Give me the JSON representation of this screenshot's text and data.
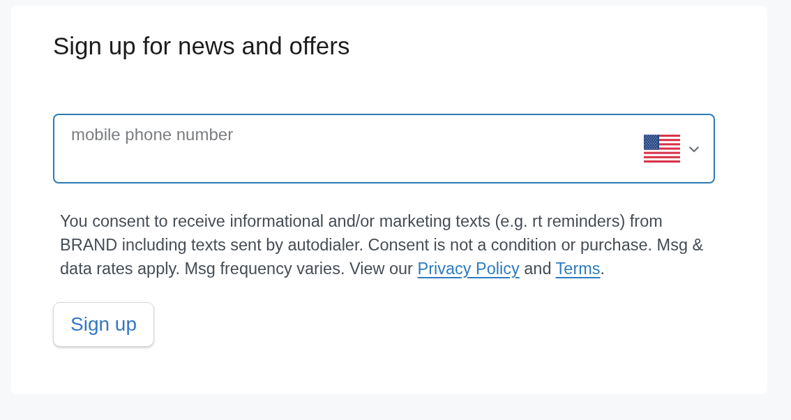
{
  "form": {
    "title": "Sign up for news and offers",
    "phone_field": {
      "placeholder": "mobile phone number",
      "focused": true
    },
    "consent": [
      {
        "kind": "text",
        "text": "You consent to receive informational and/or marketing texts (e.g. rt reminders) from BRAND including texts sent by autodialer. Consent is not a condition or purchase. Msg & data rates apply. Msg frequency varies. View our "
      },
      {
        "kind": "link",
        "text": "Privacy Policy"
      },
      {
        "kind": "text",
        "text": " and "
      },
      {
        "kind": "link",
        "text": "Terms"
      },
      {
        "kind": "text",
        "text": "."
      }
    ],
    "buttons": [
      {
        "label": "Sign up"
      }
    ]
  }
}
